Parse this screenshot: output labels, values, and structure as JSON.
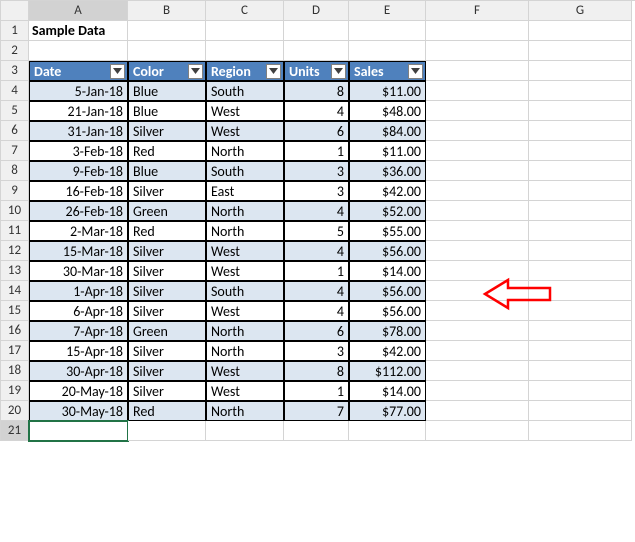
{
  "columns": [
    "A",
    "B",
    "C",
    "D",
    "E",
    "F",
    "G"
  ],
  "row_numbers_from": 1,
  "row_count": 21,
  "title": "Sample Data",
  "table": {
    "headers": [
      "Date",
      "Color",
      "Region",
      "Units",
      "Sales"
    ],
    "rows": [
      {
        "date": "5-Jan-18",
        "color": "Blue",
        "region": "South",
        "units": "8",
        "sales": "$11.00"
      },
      {
        "date": "21-Jan-18",
        "color": "Blue",
        "region": "West",
        "units": "4",
        "sales": "$48.00"
      },
      {
        "date": "31-Jan-18",
        "color": "Silver",
        "region": "West",
        "units": "6",
        "sales": "$84.00"
      },
      {
        "date": "3-Feb-18",
        "color": "Red",
        "region": "North",
        "units": "1",
        "sales": "$11.00"
      },
      {
        "date": "9-Feb-18",
        "color": "Blue",
        "region": "South",
        "units": "3",
        "sales": "$36.00"
      },
      {
        "date": "16-Feb-18",
        "color": "Silver",
        "region": "East",
        "units": "3",
        "sales": "$42.00"
      },
      {
        "date": "26-Feb-18",
        "color": "Green",
        "region": "North",
        "units": "4",
        "sales": "$52.00"
      },
      {
        "date": "2-Mar-18",
        "color": "Red",
        "region": "North",
        "units": "5",
        "sales": "$55.00"
      },
      {
        "date": "15-Mar-18",
        "color": "Silver",
        "region": "West",
        "units": "4",
        "sales": "$56.00"
      },
      {
        "date": "30-Mar-18",
        "color": "Silver",
        "region": "West",
        "units": "1",
        "sales": "$14.00"
      },
      {
        "date": "1-Apr-18",
        "color": "Silver",
        "region": "South",
        "units": "4",
        "sales": "$56.00"
      },
      {
        "date": "6-Apr-18",
        "color": "Silver",
        "region": "West",
        "units": "4",
        "sales": "$56.00"
      },
      {
        "date": "7-Apr-18",
        "color": "Green",
        "region": "North",
        "units": "6",
        "sales": "$78.00"
      },
      {
        "date": "15-Apr-18",
        "color": "Silver",
        "region": "North",
        "units": "3",
        "sales": "$42.00"
      },
      {
        "date": "30-Apr-18",
        "color": "Silver",
        "region": "West",
        "units": "8",
        "sales": "$112.00"
      },
      {
        "date": "20-May-18",
        "color": "Silver",
        "region": "West",
        "units": "1",
        "sales": "$14.00"
      },
      {
        "date": "30-May-18",
        "color": "Red",
        "region": "North",
        "units": "7",
        "sales": "$77.00"
      }
    ]
  },
  "chart_data": {
    "type": "table",
    "title": "Sample Data",
    "columns": [
      "Date",
      "Color",
      "Region",
      "Units",
      "Sales"
    ],
    "rows": [
      [
        "5-Jan-18",
        "Blue",
        "South",
        8,
        11.0
      ],
      [
        "21-Jan-18",
        "Blue",
        "West",
        4,
        48.0
      ],
      [
        "31-Jan-18",
        "Silver",
        "West",
        6,
        84.0
      ],
      [
        "3-Feb-18",
        "Red",
        "North",
        1,
        11.0
      ],
      [
        "9-Feb-18",
        "Blue",
        "South",
        3,
        36.0
      ],
      [
        "16-Feb-18",
        "Silver",
        "East",
        3,
        42.0
      ],
      [
        "26-Feb-18",
        "Green",
        "North",
        4,
        52.0
      ],
      [
        "2-Mar-18",
        "Red",
        "North",
        5,
        55.0
      ],
      [
        "15-Mar-18",
        "Silver",
        "West",
        4,
        56.0
      ],
      [
        "30-Mar-18",
        "Silver",
        "West",
        1,
        14.0
      ],
      [
        "1-Apr-18",
        "Silver",
        "South",
        4,
        56.0
      ],
      [
        "6-Apr-18",
        "Silver",
        "West",
        4,
        56.0
      ],
      [
        "7-Apr-18",
        "Green",
        "North",
        6,
        78.0
      ],
      [
        "15-Apr-18",
        "Silver",
        "North",
        3,
        42.0
      ],
      [
        "30-Apr-18",
        "Silver",
        "West",
        8,
        112.0
      ],
      [
        "20-May-18",
        "Silver",
        "West",
        1,
        14.0
      ],
      [
        "30-May-18",
        "Red",
        "North",
        7,
        77.0
      ]
    ]
  },
  "selected_cell": {
    "col": "A",
    "row": 21
  }
}
